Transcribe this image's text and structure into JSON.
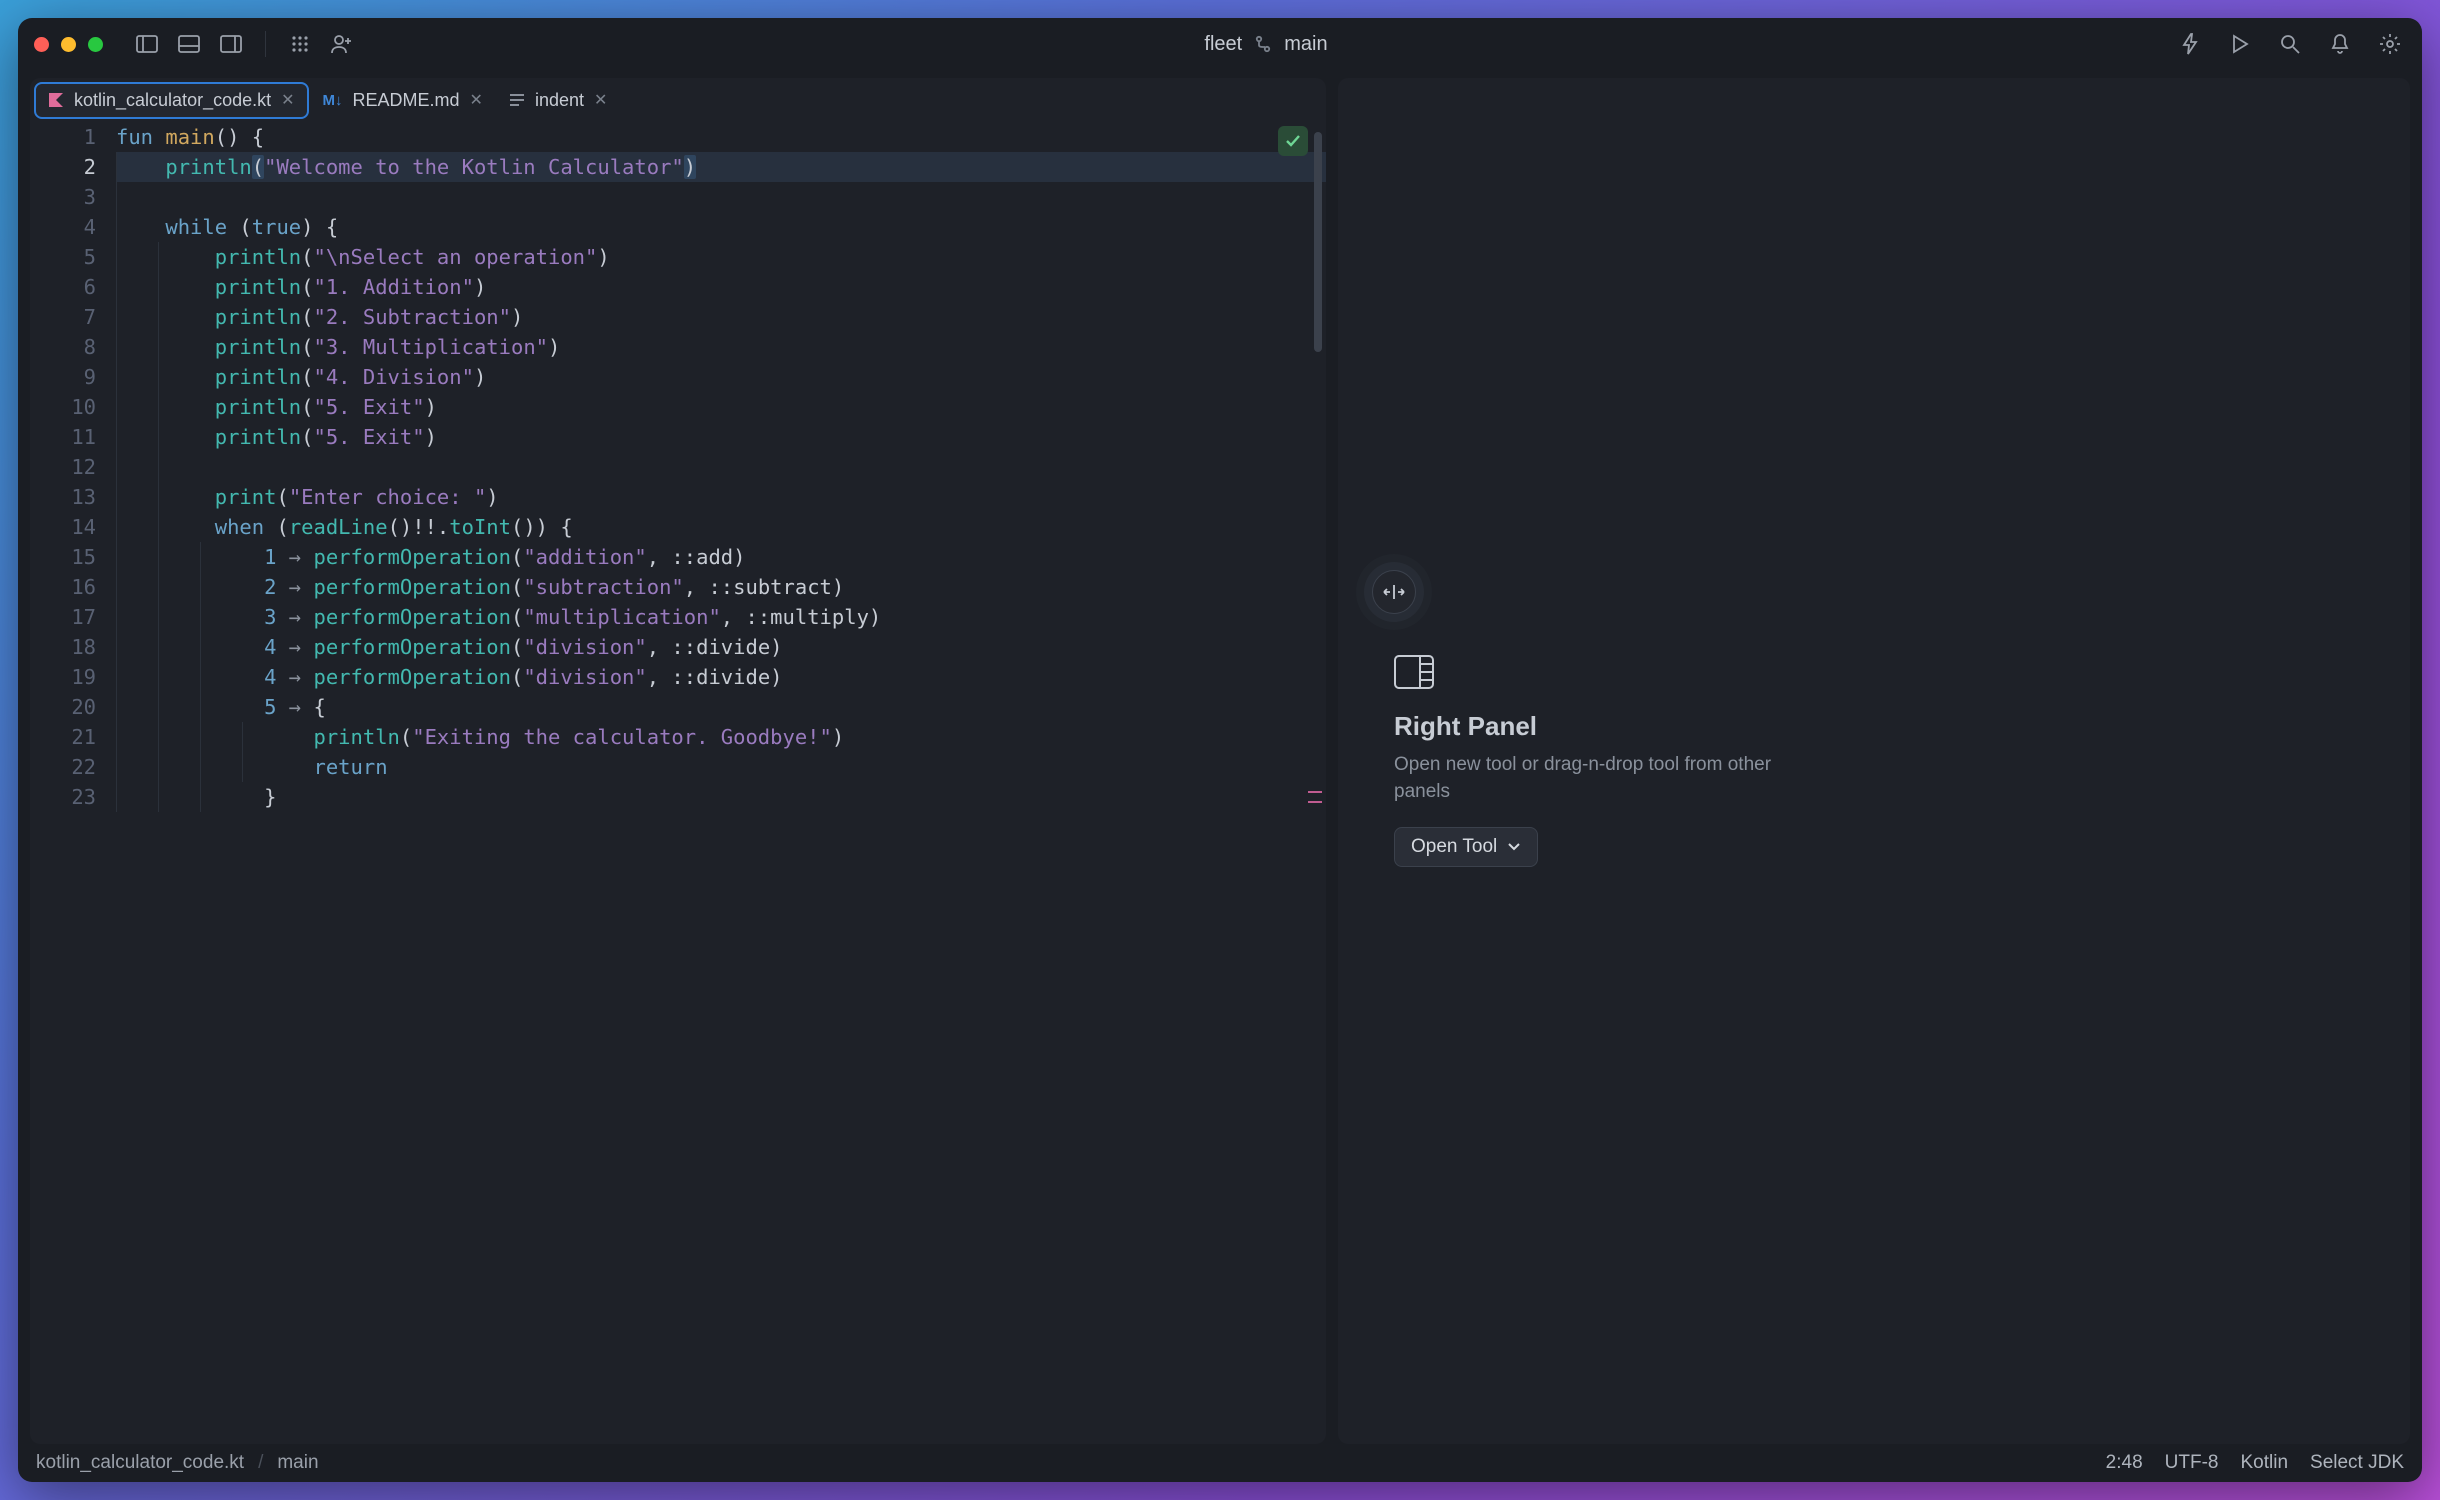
{
  "titlebar": {
    "project": "fleet",
    "branch": "main"
  },
  "tabs": [
    {
      "label": "kotlin_calculator_code.kt",
      "kind": "kt",
      "active": true
    },
    {
      "label": "README.md",
      "kind": "md",
      "active": false
    },
    {
      "label": "indent",
      "kind": "txt",
      "active": false
    }
  ],
  "editor": {
    "current_line": 2,
    "line_count": 23,
    "lines": [
      {
        "n": 1,
        "indent": 0,
        "tokens": [
          [
            "kw",
            "fun "
          ],
          [
            "fname",
            "main"
          ],
          [
            "par",
            "() {"
          ]
        ]
      },
      {
        "n": 2,
        "indent": 1,
        "selected": true,
        "tokens": [
          [
            "fn",
            "println"
          ],
          [
            "par hp",
            "("
          ],
          [
            "str",
            "\"Welcome to the Kotlin Calculator\""
          ],
          [
            "par hp",
            ")"
          ]
        ]
      },
      {
        "n": 3,
        "indent": 1,
        "tokens": []
      },
      {
        "n": 4,
        "indent": 1,
        "tokens": [
          [
            "kw",
            "while"
          ],
          [
            "par",
            " ("
          ],
          [
            "kw",
            "true"
          ],
          [
            "par",
            ") {"
          ]
        ]
      },
      {
        "n": 5,
        "indent": 2,
        "tokens": [
          [
            "fn",
            "println"
          ],
          [
            "par",
            "("
          ],
          [
            "str",
            "\"\\nSelect an operation\""
          ],
          [
            "par",
            ")"
          ]
        ]
      },
      {
        "n": 6,
        "indent": 2,
        "tokens": [
          [
            "fn",
            "println"
          ],
          [
            "par",
            "("
          ],
          [
            "str",
            "\"1. Addition\""
          ],
          [
            "par",
            ")"
          ]
        ]
      },
      {
        "n": 7,
        "indent": 2,
        "tokens": [
          [
            "fn",
            "println"
          ],
          [
            "par",
            "("
          ],
          [
            "str",
            "\"2. Subtraction\""
          ],
          [
            "par",
            ")"
          ]
        ]
      },
      {
        "n": 8,
        "indent": 2,
        "tokens": [
          [
            "fn",
            "println"
          ],
          [
            "par",
            "("
          ],
          [
            "str",
            "\"3. Multiplication\""
          ],
          [
            "par",
            ")"
          ]
        ]
      },
      {
        "n": 9,
        "indent": 2,
        "tokens": [
          [
            "fn",
            "println"
          ],
          [
            "par",
            "("
          ],
          [
            "str",
            "\"4. Division\""
          ],
          [
            "par",
            ")"
          ]
        ]
      },
      {
        "n": 10,
        "indent": 2,
        "tokens": [
          [
            "fn",
            "println"
          ],
          [
            "par",
            "("
          ],
          [
            "str",
            "\"5. Exit\""
          ],
          [
            "par",
            ")"
          ]
        ]
      },
      {
        "n": 11,
        "indent": 2,
        "tokens": [
          [
            "fn",
            "println"
          ],
          [
            "par",
            "("
          ],
          [
            "str",
            "\"5. Exit\""
          ],
          [
            "par",
            ")"
          ]
        ]
      },
      {
        "n": 12,
        "indent": 2,
        "tokens": []
      },
      {
        "n": 13,
        "indent": 2,
        "tokens": [
          [
            "fn",
            "print"
          ],
          [
            "par",
            "("
          ],
          [
            "str",
            "\"Enter choice: \""
          ],
          [
            "par",
            ")"
          ]
        ]
      },
      {
        "n": 14,
        "indent": 2,
        "tokens": [
          [
            "kw",
            "when"
          ],
          [
            "par",
            " ("
          ],
          [
            "fn",
            "readLine"
          ],
          [
            "par",
            "()!!."
          ],
          [
            "fn",
            "toInt"
          ],
          [
            "par",
            "()) {"
          ]
        ]
      },
      {
        "n": 15,
        "indent": 3,
        "tokens": [
          [
            "num",
            "1"
          ],
          [
            "arr",
            " → "
          ],
          [
            "fn",
            "performOperation"
          ],
          [
            "par",
            "("
          ],
          [
            "str",
            "\"addition\""
          ],
          [
            "par",
            ", ::"
          ],
          [
            "op",
            "add"
          ],
          [
            "par",
            ")"
          ]
        ]
      },
      {
        "n": 16,
        "indent": 3,
        "tokens": [
          [
            "num",
            "2"
          ],
          [
            "arr",
            " → "
          ],
          [
            "fn",
            "performOperation"
          ],
          [
            "par",
            "("
          ],
          [
            "str",
            "\"subtraction\""
          ],
          [
            "par",
            ", ::"
          ],
          [
            "op",
            "subtract"
          ],
          [
            "par",
            ")"
          ]
        ]
      },
      {
        "n": 17,
        "indent": 3,
        "tokens": [
          [
            "num",
            "3"
          ],
          [
            "arr",
            " → "
          ],
          [
            "fn",
            "performOperation"
          ],
          [
            "par",
            "("
          ],
          [
            "str",
            "\"multiplication\""
          ],
          [
            "par",
            ", ::"
          ],
          [
            "op",
            "multiply"
          ],
          [
            "par",
            ")"
          ]
        ]
      },
      {
        "n": 18,
        "indent": 3,
        "tokens": [
          [
            "num",
            "4"
          ],
          [
            "arr",
            " → "
          ],
          [
            "fn",
            "performOperation"
          ],
          [
            "par",
            "("
          ],
          [
            "str",
            "\"division\""
          ],
          [
            "par",
            ", ::"
          ],
          [
            "op",
            "divide"
          ],
          [
            "par",
            ")"
          ]
        ]
      },
      {
        "n": 19,
        "indent": 3,
        "tokens": [
          [
            "num",
            "4"
          ],
          [
            "arr",
            " → "
          ],
          [
            "fn",
            "performOperation"
          ],
          [
            "par",
            "("
          ],
          [
            "str",
            "\"division\""
          ],
          [
            "par",
            ", ::"
          ],
          [
            "op",
            "divide"
          ],
          [
            "par",
            ")"
          ]
        ]
      },
      {
        "n": 20,
        "indent": 3,
        "tokens": [
          [
            "num",
            "5"
          ],
          [
            "arr",
            " → "
          ],
          [
            "par",
            "{"
          ]
        ]
      },
      {
        "n": 21,
        "indent": 4,
        "tokens": [
          [
            "fn",
            "println"
          ],
          [
            "par",
            "("
          ],
          [
            "str",
            "\"Exiting the calculator. Goodbye!\""
          ],
          [
            "par",
            ")"
          ]
        ]
      },
      {
        "n": 22,
        "indent": 4,
        "tokens": [
          [
            "kw",
            "return"
          ]
        ]
      },
      {
        "n": 23,
        "indent": 3,
        "tokens": [
          [
            "par",
            "}"
          ]
        ]
      }
    ]
  },
  "right_panel": {
    "title": "Right Panel",
    "desc": "Open new tool or drag-n-drop tool from other panels",
    "button": "Open Tool"
  },
  "statusbar": {
    "file": "kotlin_calculator_code.kt",
    "scope": "main",
    "cursor": "2:48",
    "encoding": "UTF-8",
    "lang": "Kotlin",
    "jdk": "Select JDK"
  }
}
